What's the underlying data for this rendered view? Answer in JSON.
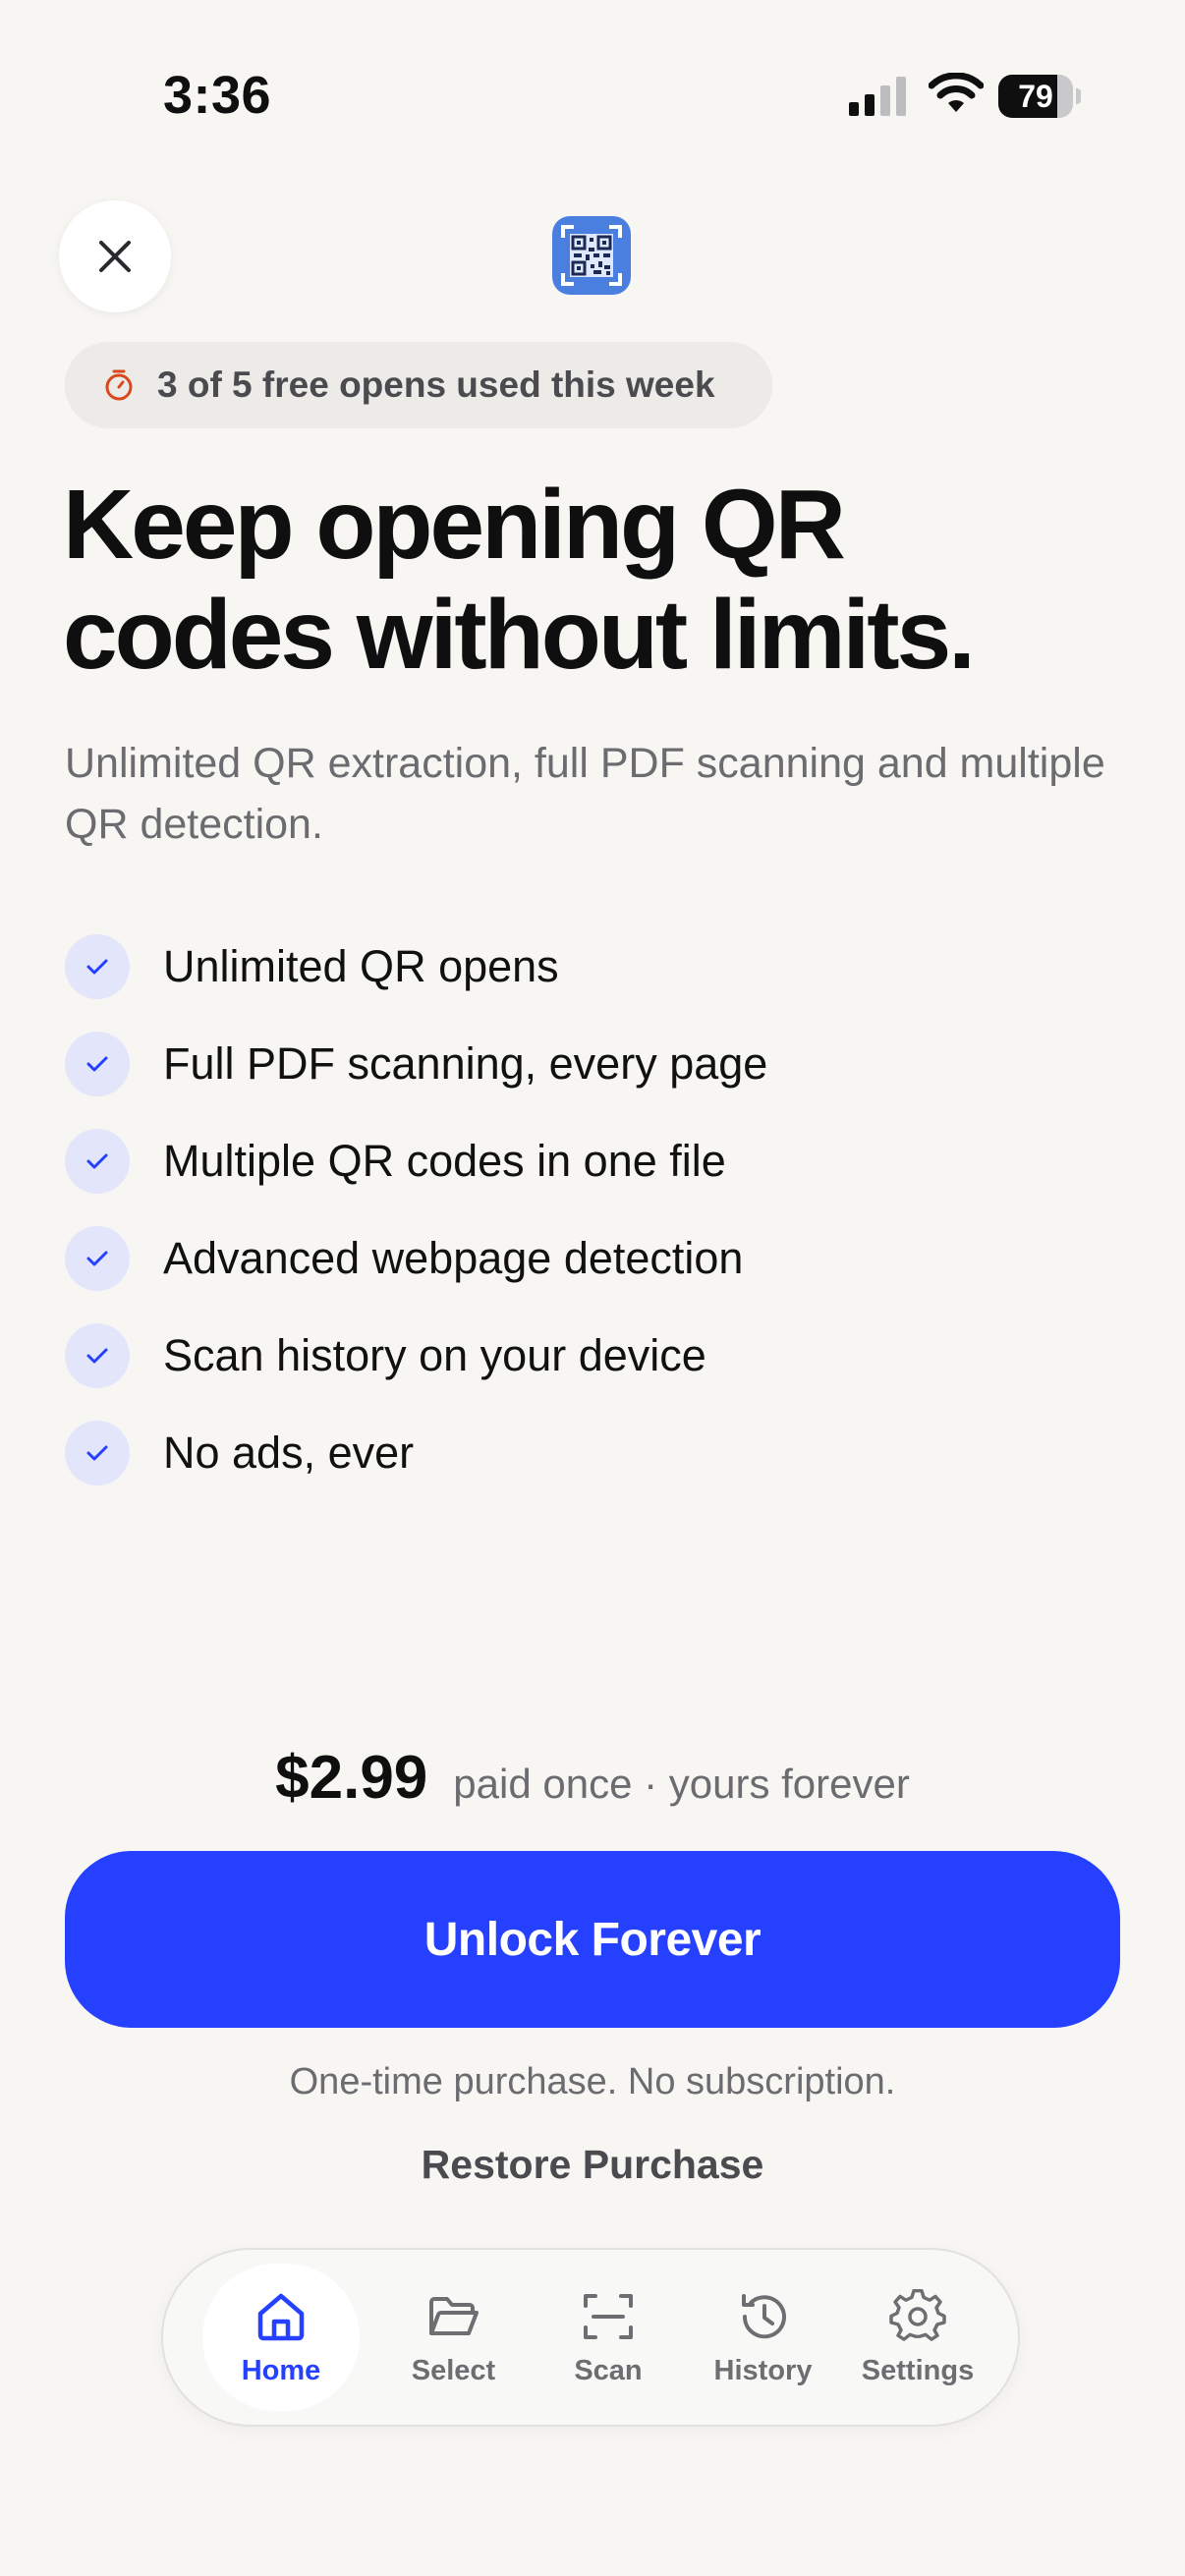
{
  "status_bar": {
    "time": "3:36",
    "battery_level": "79",
    "battery_fraction": 0.79
  },
  "header": {
    "close_icon": "close-icon",
    "logo_icon": "qr-code-icon"
  },
  "usage_badge": {
    "icon": "timer-icon",
    "text": "3 of 5 free opens used this week",
    "accent": "#d9481c"
  },
  "headline": "Keep opening QR codes without limits.",
  "subheadline": "Unlimited QR extraction, full PDF scanning and multiple QR detection.",
  "features": [
    "Unlimited QR opens",
    "Full PDF scanning, every page",
    "Multiple QR codes in one file",
    "Advanced webpage detection",
    "Scan history on your device",
    "No ads, ever"
  ],
  "pricing": {
    "price": "$2.99",
    "note": "paid once · yours forever"
  },
  "cta": {
    "label": "Unlock Forever",
    "color": "#2541ff"
  },
  "fine_print": "One-time purchase. No subscription.",
  "restore_label": "Restore Purchase",
  "tab_bar": {
    "active": "Home",
    "tabs": [
      {
        "label": "Home",
        "icon": "home-icon"
      },
      {
        "label": "Select",
        "icon": "folder-icon"
      },
      {
        "label": "Scan",
        "icon": "scan-icon"
      },
      {
        "label": "History",
        "icon": "history-icon"
      },
      {
        "label": "Settings",
        "icon": "gear-icon"
      }
    ]
  }
}
